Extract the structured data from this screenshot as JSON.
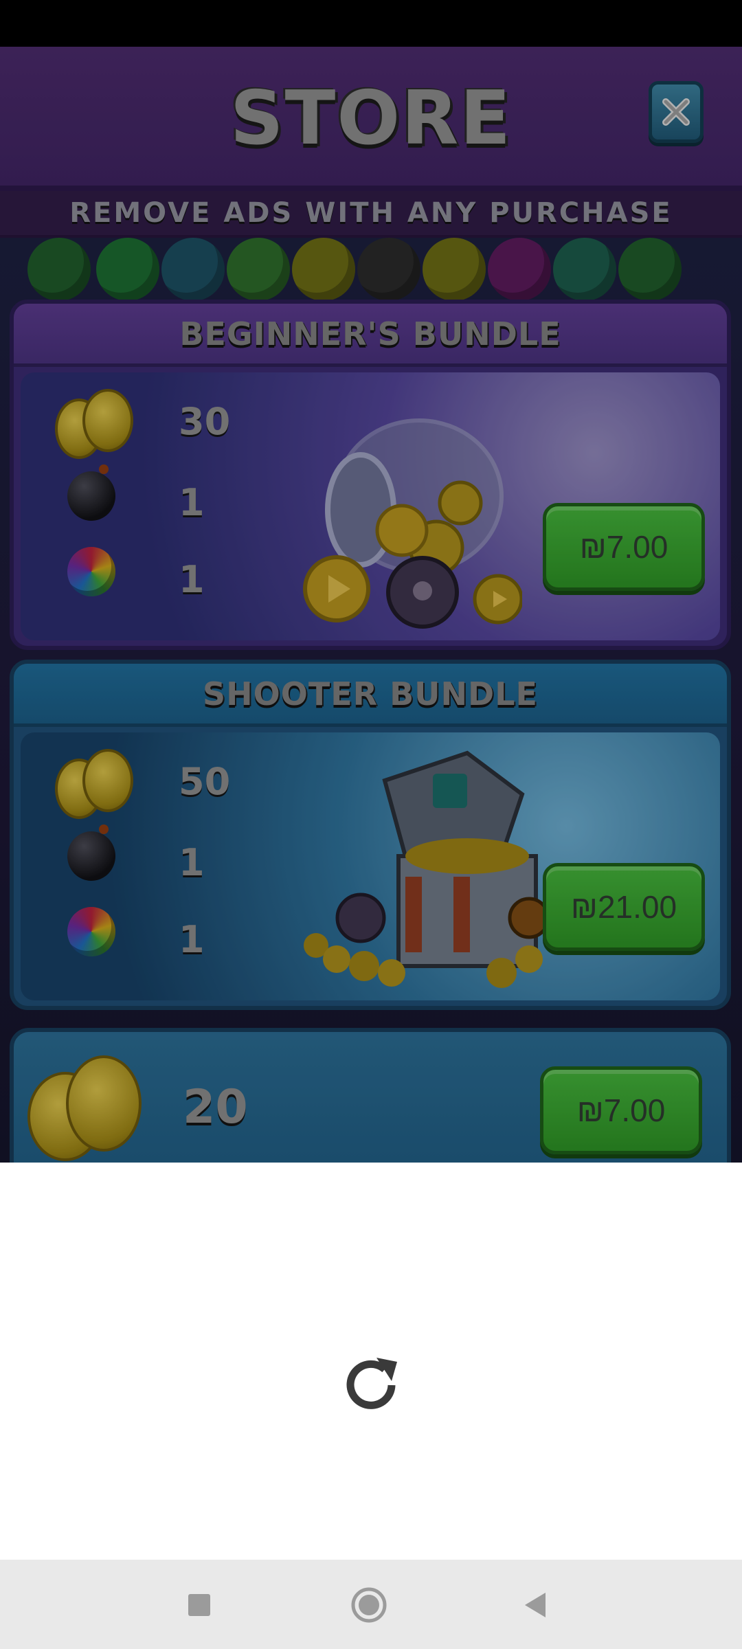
{
  "store": {
    "title": "STORE",
    "close_icon": "close-icon",
    "banner_text": "REMOVE ADS WITH ANY PURCHASE"
  },
  "bundles": [
    {
      "title": "BEGINNER'S BUNDLE",
      "items": [
        {
          "icon": "coins-icon",
          "qty": "30"
        },
        {
          "icon": "bomb-icon",
          "qty": "1"
        },
        {
          "icon": "rainbow-ball-icon",
          "qty": "1"
        }
      ],
      "art": "coin-jar-illustration",
      "price": "₪7.00"
    },
    {
      "title": "SHOOTER BUNDLE",
      "items": [
        {
          "icon": "coins-icon",
          "qty": "50"
        },
        {
          "icon": "bomb-icon",
          "qty": "1"
        },
        {
          "icon": "rainbow-ball-icon",
          "qty": "1"
        }
      ],
      "art": "treasure-chest-illustration",
      "price": "₪21.00"
    }
  ],
  "coin_pack": {
    "icon": "coins-icon",
    "qty": "20",
    "price": "₪7.00"
  },
  "webview": {
    "reload_icon": "reload-icon"
  },
  "navigation": {
    "recents_icon": "square-icon",
    "home_icon": "circle-icon",
    "back_icon": "triangle-back-icon"
  },
  "colors": {
    "header_purple": "#4a2a6a",
    "price_green": "#43b03a",
    "nav_bar": "#e9e9e9"
  }
}
